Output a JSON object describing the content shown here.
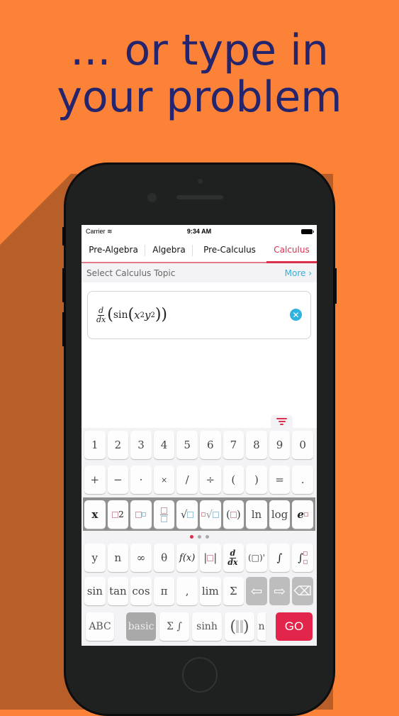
{
  "headline": {
    "line1": "... or type in",
    "line2": "your problem"
  },
  "status_bar": {
    "carrier": "Carrier",
    "time": "9:34 AM"
  },
  "tabs": [
    {
      "label": "Pre-Algebra",
      "active": false
    },
    {
      "label": "Algebra",
      "active": false
    },
    {
      "label": "Pre-Calculus",
      "active": false
    },
    {
      "label": "Calculus",
      "active": true
    }
  ],
  "topic_bar": {
    "label": "Select Calculus Topic",
    "more": "More ›"
  },
  "input": {
    "expression": "d/dx(sin(x^2 y^2))",
    "frac_num": "d",
    "frac_den": "dx",
    "func": "sin",
    "var1": "x",
    "exp1": "2",
    "var2": "y",
    "exp2": "2",
    "clear_icon": "✕"
  },
  "keyboard": {
    "row_numbers": [
      "1",
      "2",
      "3",
      "4",
      "5",
      "6",
      "7",
      "8",
      "9",
      "0"
    ],
    "row_operators": [
      "+",
      "−",
      "·",
      "×",
      "/",
      "÷",
      "(",
      ")",
      "=",
      "."
    ],
    "row_functions": {
      "x": "x",
      "square": "2",
      "ln": "ln",
      "log": "log",
      "e": "e",
      "paren_open": "(",
      "paren_close": ")",
      "sqrt": "√"
    },
    "page_dots": {
      "count": 3,
      "active": 0
    },
    "row_calc": {
      "y": "y",
      "n": "n",
      "inf": "∞",
      "theta": "θ",
      "fx": "f(x)",
      "ddx_num": "d",
      "ddx_den": "dx",
      "prime": "(□)'",
      "integral": "∫",
      "def_integral": "∫"
    },
    "row_trig": {
      "sin": "sin",
      "tan": "tan",
      "cos": "cos",
      "pi": "π",
      "comma": ",",
      "lim": "lim",
      "sigma": "Σ",
      "left": "⇦",
      "right": "⇨",
      "backspace": "⌫"
    },
    "bottom": {
      "abc": "ABC",
      "basic": "basic",
      "sigma_int": "Σ ∫",
      "sinh": "sinh",
      "matrix": "( )",
      "partial": "n",
      "go": "GO"
    }
  },
  "colors": {
    "background": "#fc8237",
    "headline": "#24256d",
    "accent": "#d9304e",
    "link": "#2eb2e0",
    "go": "#e2254a"
  }
}
